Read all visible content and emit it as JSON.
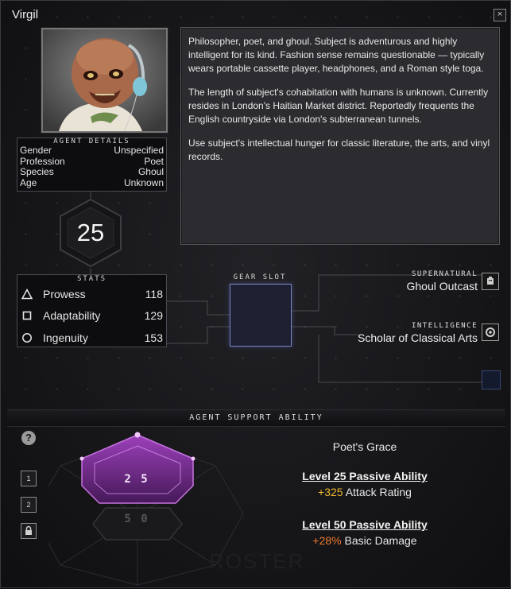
{
  "window": {
    "title": "Virgil",
    "close_label": "×"
  },
  "agent": {
    "name": "Virgil",
    "level": "25",
    "description": [
      "Philosopher, poet, and ghoul. Subject is adventurous and highly intelligent for its kind. Fashion sense remains questionable — typically wears portable cassette player, headphones, and a Roman style toga.",
      "The length of subject's cohabitation with humans is unknown. Currently resides in London's Haitian Market district. Reportedly frequents the English countryside via London's subterranean tunnels.",
      "Use subject's intellectual hunger for classic literature, the arts, and vinyl records."
    ]
  },
  "details": {
    "title": "AGENT DETAILS",
    "rows": [
      {
        "label": "Gender",
        "value": "Unspecified"
      },
      {
        "label": "Profession",
        "value": "Poet"
      },
      {
        "label": "Species",
        "value": "Ghoul"
      },
      {
        "label": "Age",
        "value": "Unknown"
      }
    ]
  },
  "stats": {
    "title": "STATS",
    "rows": [
      {
        "label": "Prowess",
        "value": "118",
        "icon": "triangle-icon"
      },
      {
        "label": "Adaptability",
        "value": "129",
        "icon": "square-icon"
      },
      {
        "label": "Ingenuity",
        "value": "153",
        "icon": "circle-icon"
      }
    ]
  },
  "gear": {
    "label": "GEAR SLOT"
  },
  "traits": [
    {
      "category": "SUPERNATURAL",
      "name": "Ghoul Outcast",
      "icon": "supernatural-icon"
    },
    {
      "category": "INTELLIGENCE",
      "name": "Scholar of Classical Arts",
      "icon": "intelligence-icon"
    }
  ],
  "support": {
    "title": "AGENT SUPPORT ABILITY",
    "help_label": "?",
    "tier_buttons": [
      "1",
      "2"
    ],
    "ability_name": "Poet's Grace",
    "tiers_display": {
      "t1": "2 5",
      "t2": "5 0"
    },
    "watermark": "ROSTER",
    "levels": [
      {
        "heading": "Level 25 Passive Ability",
        "bonus": "+325",
        "effect": "Attack Rating"
      },
      {
        "heading": "Level 50 Passive Ability",
        "bonus": "+28%",
        "effect": "Basic Damage"
      }
    ]
  },
  "colors": {
    "accent_purple": "#c05ce0",
    "gold": "#f0b830",
    "orange": "#ef7a30",
    "gear_border": "#7a86c4"
  }
}
